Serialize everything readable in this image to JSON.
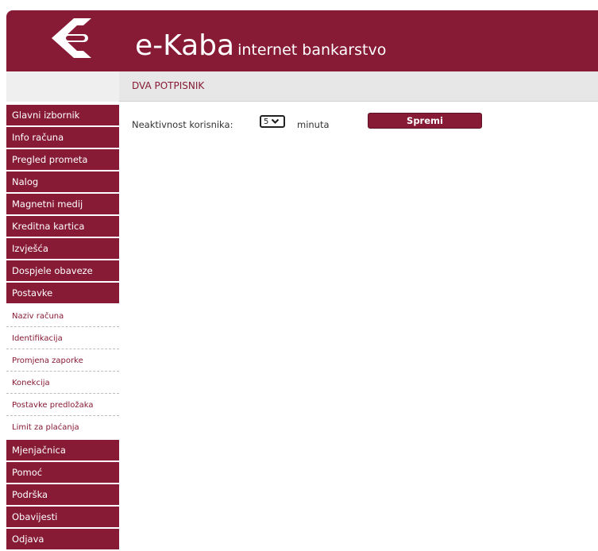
{
  "colors": {
    "brand": "#871a35",
    "titlebar_bg": "#e7e7e7",
    "sub_text": "#871a35"
  },
  "header": {
    "logo_icon": "bank-logo-icon",
    "brand_name": "e-Kaba",
    "brand_sub": "internet bankarstvo"
  },
  "page": {
    "title": "DVA POTPISNIK"
  },
  "sidebar": {
    "items": [
      {
        "label": "Glavni izbornik"
      },
      {
        "label": "Info računa"
      },
      {
        "label": "Pregled prometa"
      },
      {
        "label": "Nalog"
      },
      {
        "label": "Magnetni medij"
      },
      {
        "label": "Kreditna kartica"
      },
      {
        "label": "Izvješća"
      },
      {
        "label": "Dospjele obaveze"
      },
      {
        "label": "Postavke"
      }
    ],
    "submenu": [
      {
        "label": "Naziv računa"
      },
      {
        "label": "Identifikacija"
      },
      {
        "label": "Promjena zaporke"
      },
      {
        "label": "Konekcija"
      },
      {
        "label": "Postavke predložaka"
      },
      {
        "label": "Limit za plaćanja"
      }
    ],
    "items_after": [
      {
        "label": "Mjenjačnica"
      },
      {
        "label": "Pomoć"
      },
      {
        "label": "Podrška"
      },
      {
        "label": "Obavijesti"
      },
      {
        "label": "Odjava"
      }
    ]
  },
  "form": {
    "inactivity_label": "Neaktivnost korisnika:",
    "inactivity_value": "5",
    "unit": "minuta",
    "save_label": "Spremi",
    "dropdown_icon": "chevron-down-icon"
  }
}
